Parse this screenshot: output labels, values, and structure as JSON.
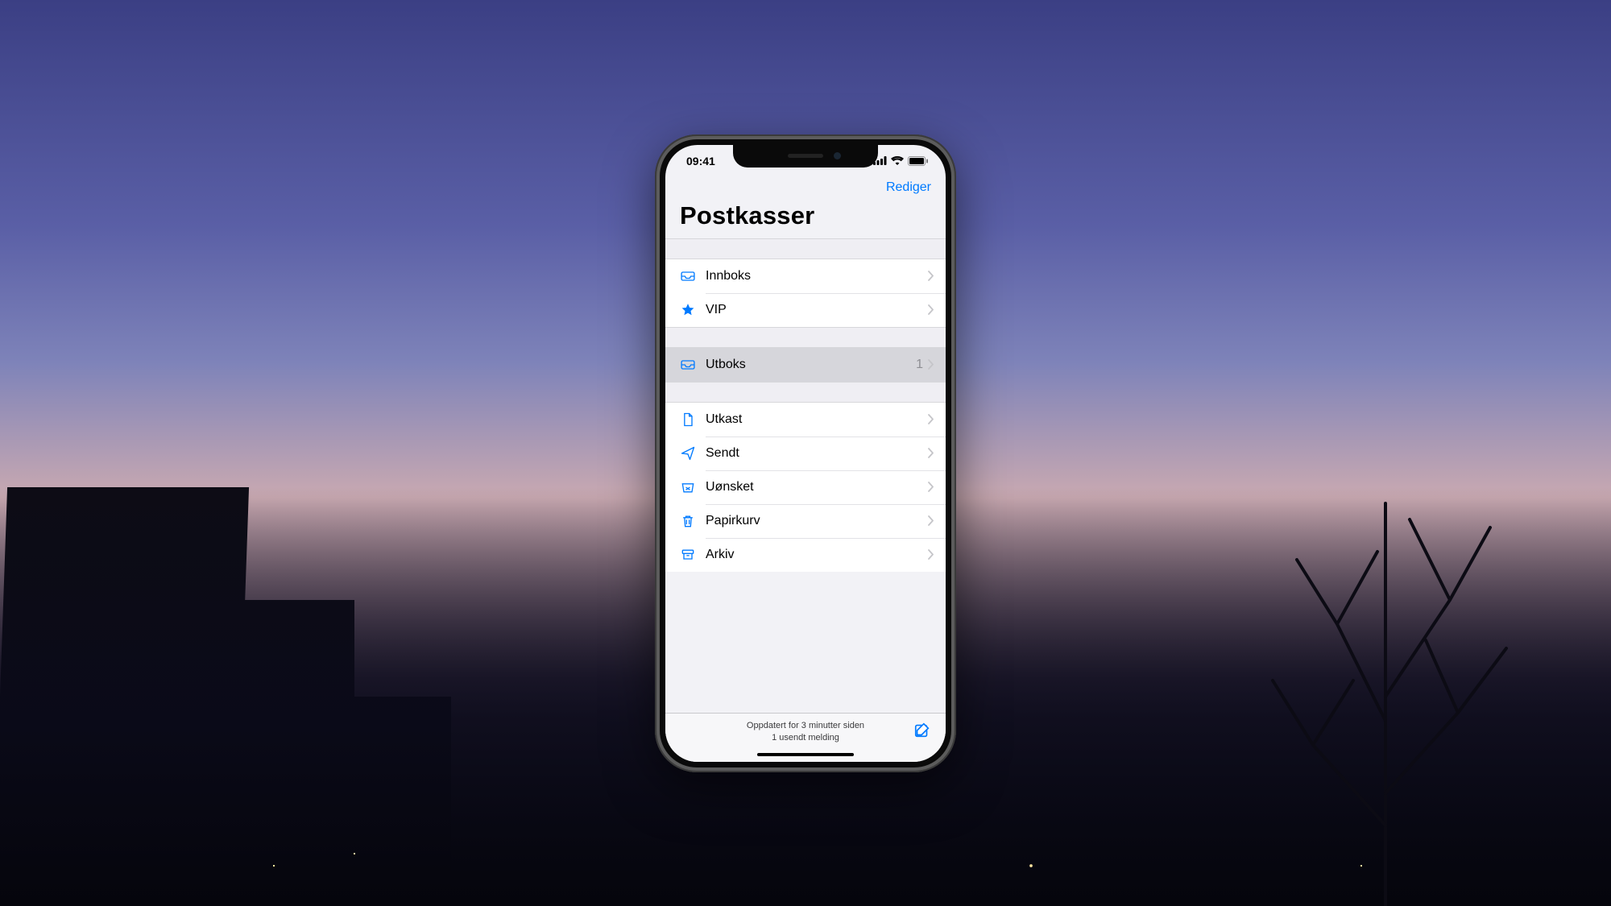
{
  "statusbar": {
    "time": "09:41"
  },
  "navbar": {
    "edit": "Rediger"
  },
  "title": "Postkasser",
  "groups": {
    "g1": [
      {
        "icon": "tray-icon",
        "label": "Innboks"
      },
      {
        "icon": "star-icon",
        "label": "VIP"
      }
    ],
    "g2": [
      {
        "icon": "tray-icon",
        "label": "Utboks",
        "count": "1",
        "selected": true
      }
    ],
    "g3": [
      {
        "icon": "doc-icon",
        "label": "Utkast"
      },
      {
        "icon": "plane-icon",
        "label": "Sendt"
      },
      {
        "icon": "junk-icon",
        "label": "Uønsket"
      },
      {
        "icon": "trash-icon",
        "label": "Papirkurv"
      },
      {
        "icon": "archive-icon",
        "label": "Arkiv"
      }
    ]
  },
  "toolbar": {
    "status_line1": "Oppdatert for 3 minutter siden",
    "status_line2": "1 usendt melding"
  }
}
